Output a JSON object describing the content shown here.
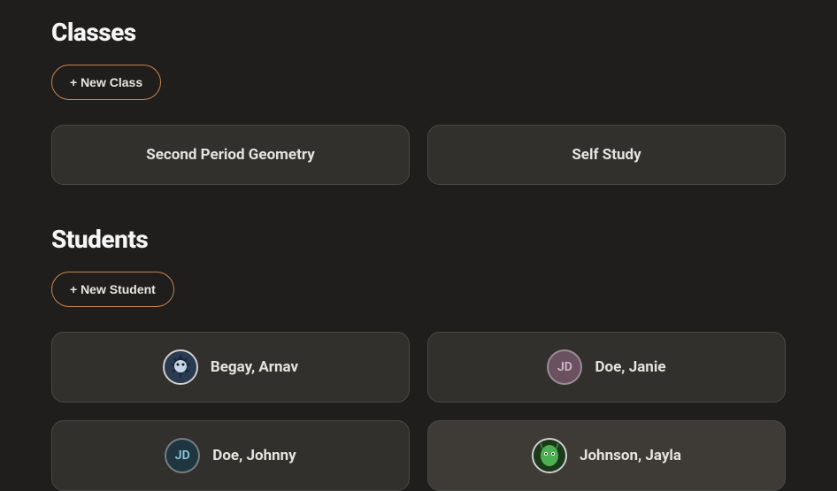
{
  "sections": {
    "classes": {
      "title": "Classes",
      "new_btn": "+ New Class",
      "items": [
        {
          "label": "Second Period Geometry"
        },
        {
          "label": "Self Study"
        }
      ]
    },
    "students": {
      "title": "Students",
      "new_btn": "+ New Student",
      "items": [
        {
          "name": "Begay, Arnav",
          "avatar_type": "image",
          "initials": "",
          "bg": "#1f2a40",
          "fg": "#b8cfe8"
        },
        {
          "name": "Doe, Janie",
          "avatar_type": "initials",
          "initials": "JD",
          "bg": "#6b5060",
          "fg": "#d2b9c8"
        },
        {
          "name": "Doe, Johnny",
          "avatar_type": "initials",
          "initials": "JD",
          "bg": "#1f3540",
          "fg": "#8fc7d9"
        },
        {
          "name": "Johnson, Jayla",
          "avatar_type": "image",
          "initials": "",
          "bg": "#1a3a1a",
          "fg": "#9ed89e"
        }
      ]
    }
  },
  "colors": {
    "accent": "#c8834e"
  }
}
